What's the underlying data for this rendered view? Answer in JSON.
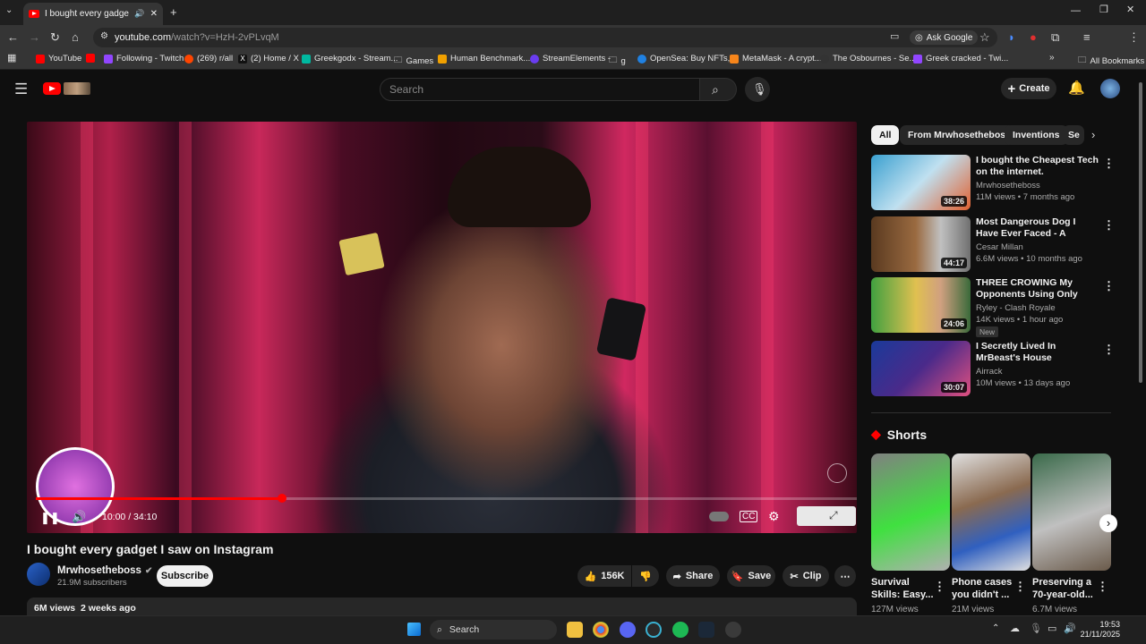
{
  "browser": {
    "tab_title": "I bought every gadget I saw",
    "url_host": "youtube.com",
    "url_path": "/watch?v=HzH-2vPLvqM",
    "ask_google": "Ask Google",
    "bookmarks": [
      "YouTube",
      "Following - Twitch",
      "(269) r/all",
      "(2) Home / X",
      "Greekgodx - Stream...",
      "Games",
      "Human Benchmark...",
      "StreamElements -",
      "g",
      "OpenSea: Buy NFTs,...",
      "MetaMask - A crypt...",
      "The Osbournes - Se...",
      "Greek cracked - Twi..."
    ],
    "all_bookmarks": "All Bookmarks"
  },
  "youtube": {
    "search_placeholder": "Search",
    "create_label": "Create"
  },
  "video": {
    "time": "10:00 / 34:10",
    "progress_fraction": 0.3,
    "title": "I bought every gadget I saw on Instagram",
    "channel": "Mrwhosetheboss",
    "subscribers": "21.9M subscribers",
    "subscribe": "Subscribe",
    "likes": "156K",
    "share": "Share",
    "save": "Save",
    "clip": "Clip",
    "views": "6M views",
    "age": "2 weeks ago"
  },
  "chips": [
    "All",
    "From Mrwhosetheboss",
    "Inventions",
    "Se"
  ],
  "recommendations": [
    {
      "title": "I bought the Cheapest Tech on the internet.",
      "channel": "Mrwhosetheboss",
      "meta": "11M views • 7 months ago",
      "duration": "38:26",
      "badge": ""
    },
    {
      "title": "Most Dangerous Dog I Have Ever Faced - A German Shepar...",
      "channel": "Cesar Millan",
      "meta": "6.6M views • 10 months ago",
      "duration": "44:17",
      "badge": ""
    },
    {
      "title": "THREE CROWING My Opponents Using Only Rocket ...",
      "channel": "Ryley - Clash Royale",
      "meta": "14K views • 1 hour ago",
      "duration": "24:06",
      "badge": "New"
    },
    {
      "title": "I Secretly Lived In MrBeast's House",
      "channel": "Airrack",
      "meta": "10M views • 13 days ago",
      "duration": "30:07",
      "badge": ""
    }
  ],
  "shorts": {
    "heading": "Shorts",
    "items": [
      {
        "title": "Survival Skills: Easy...",
        "views": "127M views"
      },
      {
        "title": "Phone cases you didn't ...",
        "views": "21M views"
      },
      {
        "title": "Preserving a 70-year-old...",
        "views": "6.7M views"
      }
    ]
  },
  "taskbar": {
    "search": "Search",
    "time": "19:53",
    "date": "21/11/2025"
  }
}
